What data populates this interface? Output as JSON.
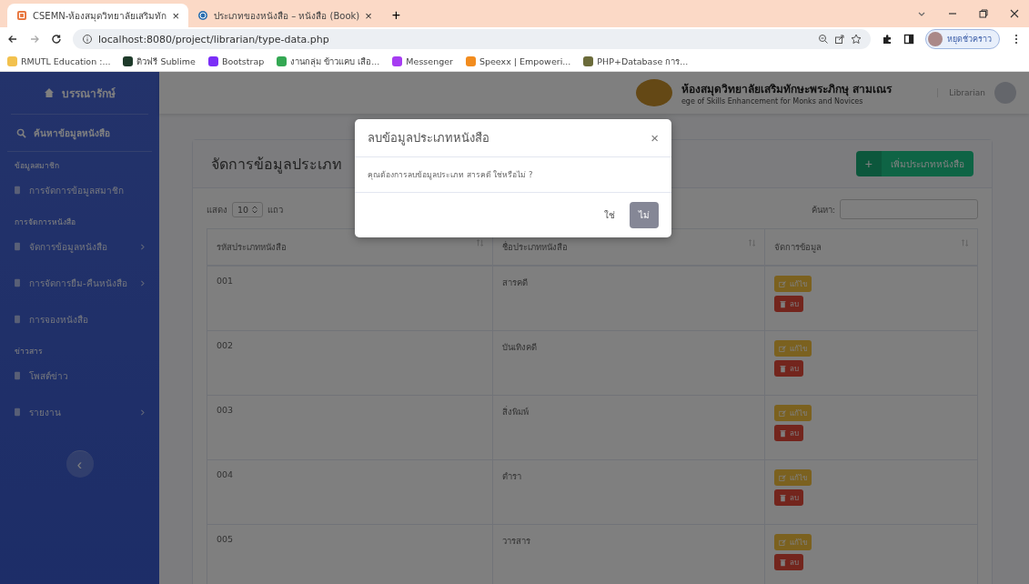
{
  "browser": {
    "tabs": [
      {
        "title": "CSEMN-ห้องสมุดวิทยาลัยเสริมทัก",
        "close": "×",
        "selected": true
      },
      {
        "title": "ประเภทของหนังสือ – หนังสือ (Book)",
        "close": "×",
        "selected": false
      }
    ],
    "new_tab": "+",
    "address": "localhost:8080/project/librarian/type-data.php",
    "profile_name": "หยุดชั่วคราว",
    "bookmarks": [
      {
        "label": "RMUTL Education :...",
        "color": "#f2c14e"
      },
      {
        "label": "ติวฟรี Sublime",
        "color": "#1e3a2a"
      },
      {
        "label": "Bootstrap",
        "color": "#7b2ff7"
      },
      {
        "label": "งานกลุ่ม ข้าวแคบ เสือ...",
        "color": "#34a853"
      },
      {
        "label": "Messenger",
        "color": "#a63cf2"
      },
      {
        "label": "Speexx | Empoweri...",
        "color": "#f28c1e"
      },
      {
        "label": "PHP+Database การ...",
        "color": "#6b6b3a"
      }
    ]
  },
  "sidebar": {
    "brand": "บรรณารักษ์",
    "toggle": "‹",
    "items": [
      {
        "kind": "search",
        "label": "ค้นหาข้อมูลหนังสือ"
      },
      {
        "kind": "heading",
        "label": "ข้อมูลสมาชิก"
      },
      {
        "kind": "item",
        "label": "การจัดการข้อมูลสมาชิก",
        "has_submenu": false
      },
      {
        "kind": "heading",
        "label": "การจัดการหนังสือ"
      },
      {
        "kind": "item",
        "label": "จัดการข้อมูลหนังสือ",
        "has_submenu": true
      },
      {
        "kind": "item",
        "label": "การจัดการยืม-คืนหนังสือ",
        "has_submenu": true
      },
      {
        "kind": "item",
        "label": "การจองหนังสือ",
        "has_submenu": false
      },
      {
        "kind": "heading",
        "label": "ข่าวสาร"
      },
      {
        "kind": "item",
        "label": "โพสต์ข่าว",
        "has_submenu": false
      },
      {
        "kind": "item",
        "label": "รายงาน",
        "has_submenu": true
      }
    ]
  },
  "topbar": {
    "title": "ห้องสมุดวิทยาลัยเสริมทักษะพระภิกษุ สามเณร",
    "subtitle": "ege of Skills Enhancement for Monks and Novices",
    "user_name": "Librarian"
  },
  "card": {
    "title": "จัดการข้อมูลประเภท",
    "add_icon": "+",
    "add_button": "เพิ่มประเภทหนังสือ",
    "show_label": "แสดง",
    "page_size": "10",
    "rows_label": "แถว",
    "search_label": "ค้นหา:",
    "columns": [
      "รหัสประเภทหนังสือ",
      "ชื่อประเภทหนังสือ",
      "จัดการข้อมูล"
    ],
    "rows": [
      {
        "code": "001",
        "name": "สารคดี",
        "edit": "แก้ไข",
        "delete": "ลบ"
      },
      {
        "code": "002",
        "name": "บันเทิงคดี",
        "edit": "แก้ไข",
        "delete": "ลบ"
      },
      {
        "code": "003",
        "name": "สิ่งพิมพ์",
        "edit": "แก้ไข",
        "delete": "ลบ"
      },
      {
        "code": "004",
        "name": "ตำรา",
        "edit": "แก้ไข",
        "delete": "ลบ"
      },
      {
        "code": "005",
        "name": "วารสาร",
        "edit": "แก้ไข",
        "delete": "ลบ"
      }
    ]
  },
  "modal": {
    "title": "ลบข้อมูลประเภทหนังสือ",
    "close": "×",
    "message": "คุณต้องการลบข้อมูลประเภท สารคดี ใช่หรือไม่ ?",
    "confirm": "ใช่",
    "cancel": "ไม่"
  }
}
